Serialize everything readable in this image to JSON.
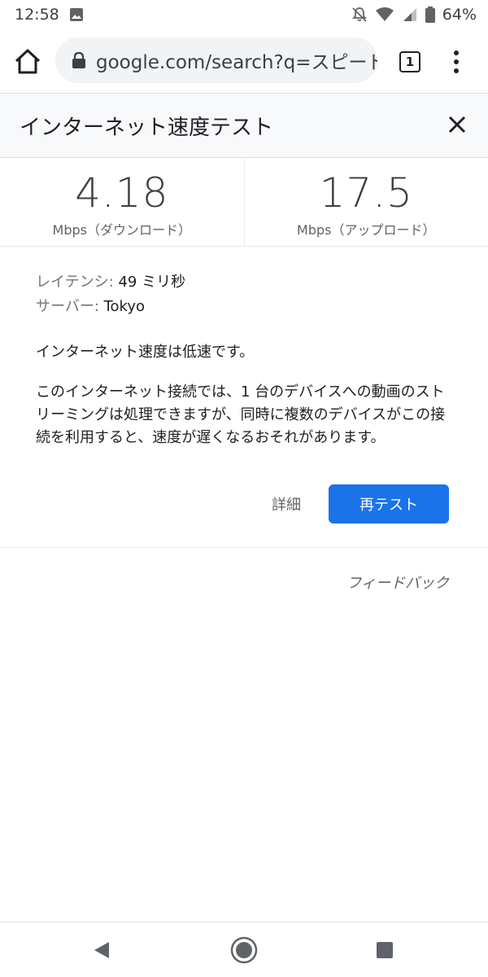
{
  "status_bar": {
    "time": "12:58",
    "battery": "64%"
  },
  "browser": {
    "url": "google.com/search?q=スピード",
    "tab_count": "1"
  },
  "panel": {
    "title": "インターネット速度テスト"
  },
  "speeds": {
    "download_value": "4.18",
    "download_unit": "Mbps（ダウンロード）",
    "upload_value": "17.5",
    "upload_unit": "Mbps（アップロード）"
  },
  "details": {
    "latency_label": "レイテンシ:",
    "latency_value": " 49 ミリ秒",
    "server_label": "サーバー:",
    "server_value": " Tokyo",
    "status": "インターネット速度は低速です。",
    "description": "このインターネット接続では、1 台のデバイスへの動画のストリーミングは処理できますが、同時に複数のデバイスがこの接続を利用すると、速度が遅くなるおそれがあります。"
  },
  "actions": {
    "details_label": "詳細",
    "retest_label": "再テスト"
  },
  "feedback_label": "フィードバック",
  "colors": {
    "accent": "#1a73e8"
  }
}
